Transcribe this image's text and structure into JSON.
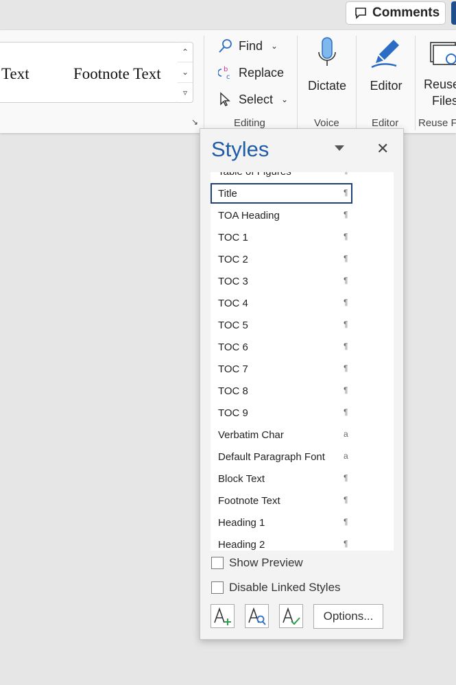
{
  "header": {
    "comments_label": "Comments"
  },
  "ribbon": {
    "gallery": {
      "items": [
        "ck Text",
        "Footnote Text"
      ]
    },
    "editing": {
      "find": "Find",
      "replace": "Replace",
      "select": "Select",
      "group_label": "Editing"
    },
    "voice": {
      "dictate": "Dictate",
      "group_label": "Voice"
    },
    "editor": {
      "editor": "Editor",
      "group_label": "Editor"
    },
    "reuse": {
      "line1": "Reuse",
      "line2": "Files",
      "group_label": "Reuse F"
    }
  },
  "styles_pane": {
    "title": "Styles",
    "close_symbol": "✕",
    "items": [
      {
        "name": "Table of Figures",
        "symbol": "¶"
      },
      {
        "name": "Title",
        "symbol": "¶"
      },
      {
        "name": "TOA Heading",
        "symbol": "¶"
      },
      {
        "name": "TOC 1",
        "symbol": "¶"
      },
      {
        "name": "TOC 2",
        "symbol": "¶"
      },
      {
        "name": "TOC 3",
        "symbol": "¶"
      },
      {
        "name": "TOC 4",
        "symbol": "¶"
      },
      {
        "name": "TOC 5",
        "symbol": "¶"
      },
      {
        "name": "TOC 6",
        "symbol": "¶"
      },
      {
        "name": "TOC 7",
        "symbol": "¶"
      },
      {
        "name": "TOC 8",
        "symbol": "¶"
      },
      {
        "name": "TOC 9",
        "symbol": "¶"
      },
      {
        "name": "Verbatim Char",
        "symbol": "a"
      },
      {
        "name": "Default Paragraph Font",
        "symbol": "a"
      },
      {
        "name": "Block Text",
        "symbol": "¶"
      },
      {
        "name": "Footnote Text",
        "symbol": "¶"
      },
      {
        "name": "Heading 1",
        "symbol": "¶"
      },
      {
        "name": "Heading 2",
        "symbol": "¶"
      }
    ],
    "selected_item": "Title",
    "show_preview": {
      "label": "Show Preview",
      "checked": false
    },
    "disable_linked": {
      "label": "Disable Linked Styles",
      "checked": false
    },
    "options_label": "Options..."
  },
  "colors": {
    "accent": "#1f5ba7",
    "selection_border": "#1f3f7a"
  }
}
